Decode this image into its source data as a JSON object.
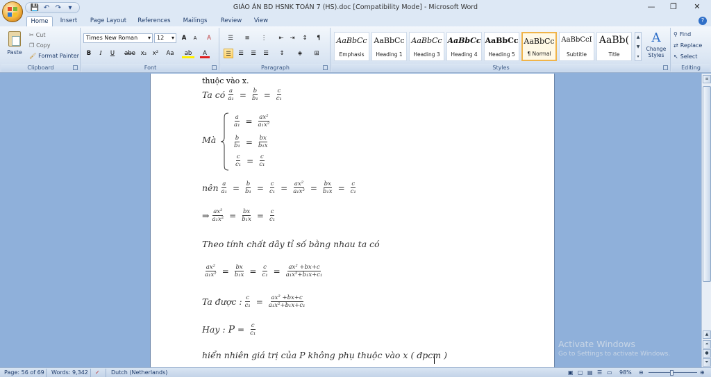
{
  "window": {
    "title": "GIÁO ÁN BD HSNK TOÁN 7 (HS).doc [Compatibility Mode] - Microsoft Word",
    "minimize": "—",
    "restore": "❐",
    "close": "✕"
  },
  "qat": {
    "save": "💾",
    "undo": "↶",
    "redo": "↷",
    "customize": "▾"
  },
  "tabs": [
    {
      "label": "Home"
    },
    {
      "label": "Insert"
    },
    {
      "label": "Page Layout"
    },
    {
      "label": "References"
    },
    {
      "label": "Mailings"
    },
    {
      "label": "Review"
    },
    {
      "label": "View"
    }
  ],
  "clipboard": {
    "paste": "Paste",
    "cut": "Cut",
    "copy": "Copy",
    "format_painter": "Format Painter",
    "label": "Clipboard"
  },
  "font": {
    "name": "Times New Roman",
    "size": "12",
    "label": "Font",
    "grow": "A",
    "shrink": "A",
    "clear": "A",
    "bold": "B",
    "italic": "I",
    "underline": "U",
    "strike": "abe",
    "sub": "x₂",
    "sup": "x²",
    "case": "Aa",
    "highlight": "ab",
    "color": "A"
  },
  "paragraph": {
    "label": "Paragraph",
    "pilcrow": "¶"
  },
  "styles": {
    "label": "Styles",
    "items": [
      {
        "sample": "AaBbCc",
        "name": "Emphasis"
      },
      {
        "sample": "AaBbCc",
        "name": "Heading 1"
      },
      {
        "sample": "AaBbCc",
        "name": "Heading 3"
      },
      {
        "sample": "AaBbCc",
        "name": "Heading 4"
      },
      {
        "sample": "AaBbCc",
        "name": "Heading 5"
      },
      {
        "sample": "AaBbCc",
        "name": "¶ Normal"
      },
      {
        "sample": "AaBbCcI",
        "name": "Subtitle"
      },
      {
        "sample": "AaBb(",
        "name": "Title"
      }
    ],
    "change_styles": "Change Styles"
  },
  "editing": {
    "label": "Editing",
    "find": "Find",
    "replace": "Replace",
    "select": "Select"
  },
  "document": {
    "line0": "thuộc vào x.",
    "ta_co": "Ta có",
    "ma": "Mà",
    "nen": "nên",
    "implies": "⇒",
    "theo": "Theo tính chất dãy tỉ số bằng nhau ta có",
    "ta_duoc": "Ta được :",
    "hay": "Hay :",
    "P": "P",
    "last": "hiển nhiên giá trị của P không phụ thuộc vào x ( đpcm )",
    "a": "a",
    "a1": "a₁",
    "b": "b",
    "b1": "b₁",
    "c": "c",
    "c1": "c₁",
    "ax2": "ax²",
    "a1x2": "a₁x²",
    "bx": "bx",
    "b1x": "b₁x",
    "sum_num": "ax² +bx+c",
    "sum_den": "a₁x²+b₁x+c₁"
  },
  "watermark": {
    "line1": "Activate Windows",
    "line2": "Go to Settings to activate Windows."
  },
  "status": {
    "page": "Page: 56 of 69",
    "words": "Words: 9,342",
    "language": "Dutch (Netherlands)",
    "zoom": "98%"
  }
}
